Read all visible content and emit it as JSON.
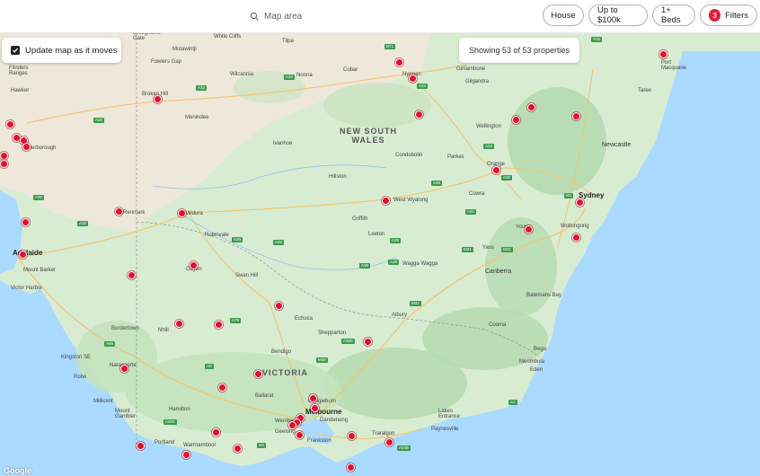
{
  "search": {
    "placeholder": "Map area"
  },
  "filters": {
    "house_label": "House",
    "price_label": "Up to $100k",
    "beds_label": "1+ Beds",
    "filters_label": "Filters",
    "filters_count": "3"
  },
  "map_controls": {
    "update_label": "Update map as it moves",
    "update_checked": true,
    "results_text": "Showing 53 of 53 properties"
  },
  "attribution": "Google",
  "colors": {
    "accent": "#e11d3a",
    "land": "#d8ecd2",
    "sea": "#aadaff",
    "park": "#b5dbb1"
  },
  "map_labels": {
    "states": [
      "NEW SOUTH\nWALES",
      "VICTORIA"
    ],
    "cities": [
      "Sydney",
      "Melbourne",
      "Adelaide",
      "Canberra",
      "Newcastle"
    ],
    "towns": [
      "Broughams Gate",
      "Mutawintji",
      "White Cliffs",
      "Tilpa",
      "Cobar",
      "Nyngan",
      "Fowlers Gap",
      "Wilcannia",
      "Noona",
      "Girilambone",
      "Gilgandra",
      "Broken Hill",
      "Menindee",
      "Flinders Ranges",
      "Hawker",
      "Peterborough",
      "Ivanhoe",
      "Wellington",
      "Condobolin",
      "Parkes",
      "Orange",
      "Hillston",
      "Cowra",
      "West Wyalong",
      "Griffith",
      "Leeton",
      "Renmark",
      "Mildura",
      "Robinvale",
      "Young",
      "Yass",
      "Wollongong",
      "Mount Barker",
      "Victor Harbor",
      "Ouyen",
      "Swan Hill",
      "Wagga Wagga",
      "Batemans Bay",
      "Bordertown",
      "Nhill",
      "Echuca",
      "Albury",
      "Shepparton",
      "Cooma",
      "Bendigo",
      "Kingston SE",
      "Naracoorte",
      "Robe",
      "Bega",
      "Merimbula",
      "Eden",
      "Ballarat",
      "Craigieburn",
      "Millicent",
      "Hamilton",
      "Mount Gambier",
      "Werribee",
      "Dandenong",
      "Lakes Entrance",
      "Paynesville",
      "Geelong",
      "Frankston",
      "Traralgon",
      "Portland",
      "Warrnambool",
      "Port Macquarie",
      "Taree"
    ]
  }
}
